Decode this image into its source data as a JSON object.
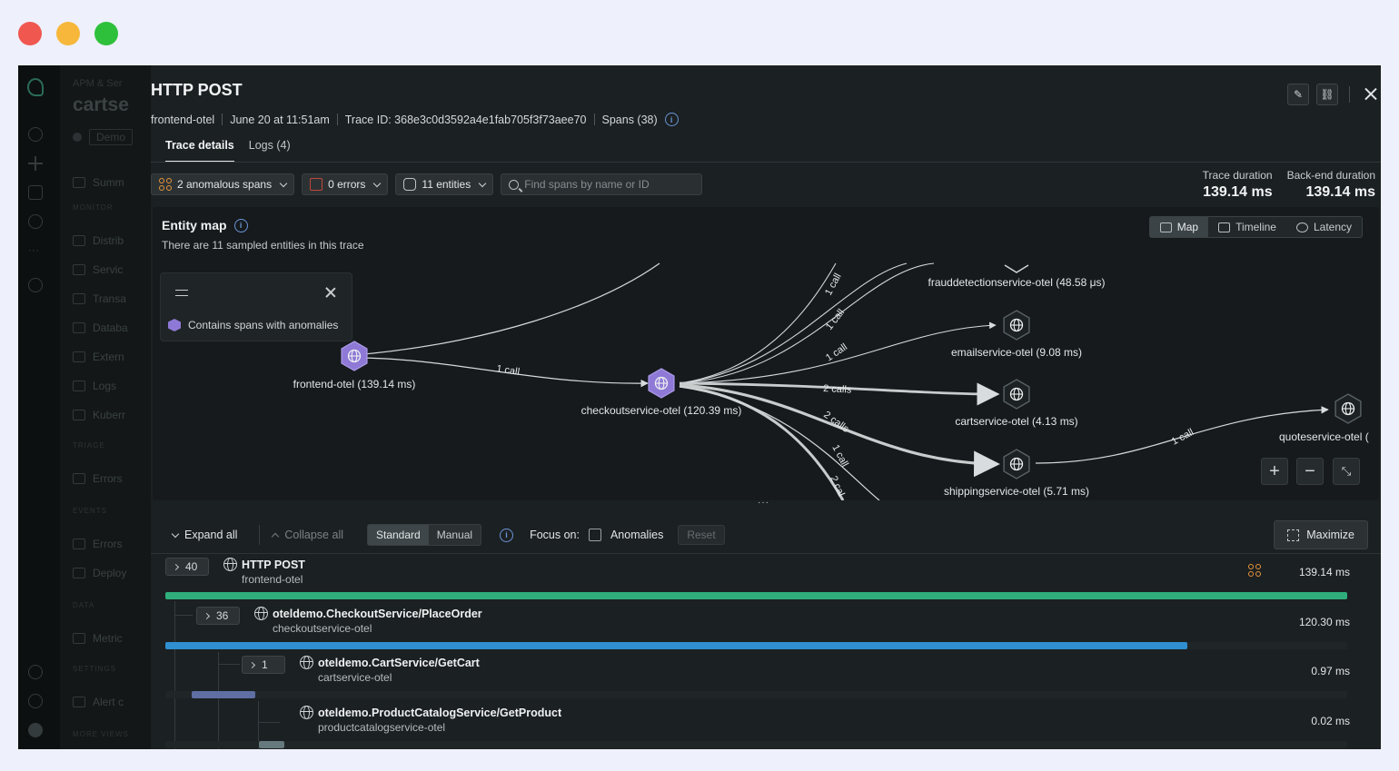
{
  "window_controls": [
    "close",
    "minimize",
    "zoom"
  ],
  "background_app": {
    "breadcrumb": "APM & Ser",
    "entity_title": "cartse",
    "tag": "Demo",
    "nav": [
      {
        "section": "",
        "label": "Summ",
        "icon": "summary-icon"
      },
      {
        "section": "MONITOR",
        "label": "Distrib",
        "icon": "distributed-tracing-icon"
      },
      {
        "section": "",
        "label": "Servic",
        "icon": "service-map-icon"
      },
      {
        "section": "",
        "label": "Transa",
        "icon": "transactions-icon"
      },
      {
        "section": "",
        "label": "Databa",
        "icon": "database-icon"
      },
      {
        "section": "",
        "label": "Extern",
        "icon": "external-icon"
      },
      {
        "section": "",
        "label": "Logs",
        "icon": "logs-icon"
      },
      {
        "section": "",
        "label": "Kuberr",
        "icon": "kubernetes-icon"
      },
      {
        "section": "TRIAGE",
        "label": "Errors",
        "icon": "errors-icon"
      },
      {
        "section": "EVENTS",
        "label": "Errors",
        "icon": "errors-icon"
      },
      {
        "section": "",
        "label": "Deploy",
        "icon": "deploy-icon"
      },
      {
        "section": "DATA",
        "label": "Metric",
        "icon": "metrics-icon"
      },
      {
        "section": "SETTINGS",
        "label": "Alert c",
        "icon": "alert-icon"
      },
      {
        "section": "MORE VIEWS",
        "label": "",
        "icon": ""
      }
    ]
  },
  "header": {
    "title": "HTTP POST",
    "service": "frontend-otel",
    "timestamp": "June 20 at 11:51am",
    "trace_id": "Trace ID: 368e3c0d3592a4e1fab705f3f73aee70",
    "spans": "Spans (38)"
  },
  "tabs": [
    {
      "label": "Trace details",
      "active": true
    },
    {
      "label": "Logs (4)",
      "active": false
    }
  ],
  "filters": {
    "anomalous": "2 anomalous spans",
    "errors": "0 errors",
    "entities": "11 entities",
    "search_placeholder": "Find spans by name or ID"
  },
  "durations": {
    "trace_label": "Trace duration",
    "trace_value": "139.14 ms",
    "backend_label": "Back-end duration",
    "backend_value": "139.14 ms"
  },
  "entity_map": {
    "title": "Entity map",
    "subtitle": "There are 11 sampled entities in this trace",
    "views": [
      {
        "label": "Map",
        "active": true,
        "icon": "map-icon"
      },
      {
        "label": "Timeline",
        "active": false,
        "icon": "timeline-icon"
      },
      {
        "label": "Latency",
        "active": false,
        "icon": "latency-icon"
      }
    ],
    "legend": {
      "label": "Contains spans with anomalies"
    },
    "nodes": [
      {
        "id": "frontend",
        "label": "frontend-otel (139.14 ms)",
        "anomalous": true
      },
      {
        "id": "checkout",
        "label": "checkoutservice-otel (120.39 ms)",
        "anomalous": true
      },
      {
        "id": "fraud",
        "label": "frauddetectionservice-otel (48.58 μs)",
        "anomalous": false
      },
      {
        "id": "email",
        "label": "emailservice-otel (9.08 ms)",
        "anomalous": false
      },
      {
        "id": "cart",
        "label": "cartservice-otel (4.13 ms)",
        "anomalous": false
      },
      {
        "id": "shipping",
        "label": "shippingservice-otel (5.71 ms)",
        "anomalous": false
      },
      {
        "id": "quote",
        "label": "quoteservice-otel (",
        "anomalous": false
      }
    ],
    "edge_labels": {
      "front_checkout": "1 call",
      "to_cart": "2 calls",
      "to_shipping": "2 calls",
      "ship_quote": "1 call",
      "fan1": "1 call",
      "fan2": "1 call",
      "fan3": "1 call",
      "fan4": "1 call",
      "fan5": "2 cal"
    }
  },
  "waterfall": {
    "expand_all": "Expand all",
    "collapse_all": "Collapse all",
    "modes": [
      {
        "label": "Standard",
        "active": true
      },
      {
        "label": "Manual",
        "active": false
      }
    ],
    "focus_label": "Focus on:",
    "anomalies_label": "Anomalies",
    "reset_label": "Reset",
    "maximize_label": "Maximize",
    "spans": [
      {
        "count": "40",
        "name": "HTTP POST",
        "service": "frontend-otel",
        "duration": "139.14 ms",
        "anomaly_flag": true,
        "bar_color": "#2fae7c",
        "start_fraction": 0.0,
        "length_fraction": 1.0
      },
      {
        "count": "36",
        "name": "oteldemo.CheckoutService/PlaceOrder",
        "service": "checkoutservice-otel",
        "duration": "120.30 ms",
        "anomaly_flag": false,
        "bar_color": "#2f8fd0",
        "start_fraction": 0.0,
        "length_fraction": 0.865
      },
      {
        "count": "1",
        "name": "oteldemo.CartService/GetCart",
        "service": "cartservice-otel",
        "duration": "0.97 ms",
        "anomaly_flag": false,
        "bar_color": "#5f6fa4",
        "start_fraction": 0.022,
        "length_fraction": 0.054
      },
      {
        "count": "",
        "name": "oteldemo.ProductCatalogService/GetProduct",
        "service": "productcatalogservice-otel",
        "duration": "0.02 ms",
        "anomaly_flag": false,
        "bar_color": "#66797d",
        "start_fraction": 0.079,
        "length_fraction": 0.022
      }
    ]
  },
  "colors": {
    "accent_purple": "#8e79d6",
    "anomaly_orange": "#e6953c",
    "error_red": "#c2453b",
    "root_bar": "#2fae7c",
    "child_bar": "#2f8fd0"
  }
}
